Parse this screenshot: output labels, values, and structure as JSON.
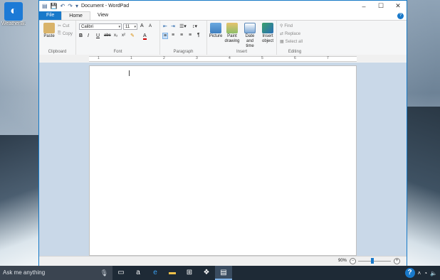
{
  "desktop": {
    "icon_label": "WeatherBl..."
  },
  "window": {
    "title": "Document - WordPad",
    "controls": {
      "minimize": "–",
      "maximize": "☐",
      "close": "✕"
    }
  },
  "tabs": {
    "file": "File",
    "home": "Home",
    "view": "View"
  },
  "ribbon": {
    "clipboard": {
      "label": "Clipboard",
      "paste": "Paste",
      "cut": "Cut",
      "copy": "Copy"
    },
    "font": {
      "label": "Font",
      "family": "Calibri",
      "size": "11",
      "grow": "A",
      "shrink": "A",
      "bold": "B",
      "italic": "I",
      "underline": "U",
      "strike": "abc",
      "sub": "x₂",
      "sup": "x²",
      "color": "A"
    },
    "paragraph": {
      "label": "Paragraph"
    },
    "insert": {
      "label": "Insert",
      "picture": "Picture",
      "paint": "Paint\ndrawing",
      "paint1": "Paint",
      "paint2": "drawing",
      "datetime1": "Date and",
      "datetime2": "time",
      "object1": "Insert",
      "object2": "object"
    },
    "editing": {
      "label": "Editing",
      "find": "Find",
      "replace": "Replace",
      "select_all": "Select all"
    }
  },
  "ruler": {
    "numbers": [
      "1",
      "1",
      "2",
      "3",
      "4",
      "5",
      "6",
      "7"
    ]
  },
  "status": {
    "zoom": "90%",
    "zoom_level": 0.5
  },
  "taskbar": {
    "search_placeholder": "Ask me anything"
  }
}
